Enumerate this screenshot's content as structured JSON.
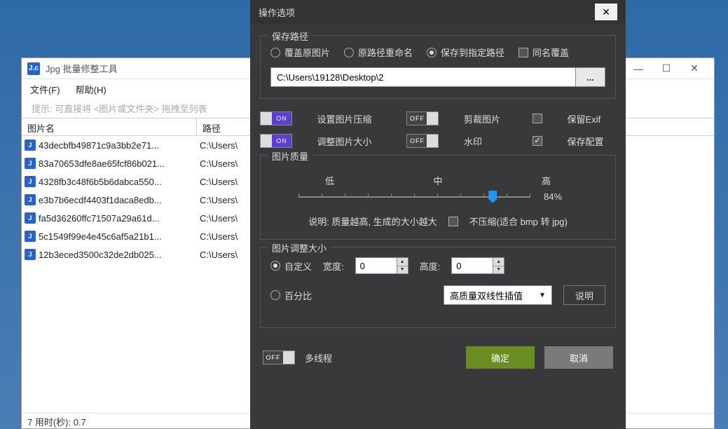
{
  "main_window": {
    "icon_text": "J.c",
    "title": "Jpg 批量修整工具",
    "menu": {
      "file": "文件(F)",
      "help": "帮助(H)"
    },
    "hint": "提示: 可直接将 <图片或文件夹> 拖拽至列表",
    "columns": {
      "name": "图片名",
      "path": "路径"
    },
    "rows": [
      {
        "name": "43decbfb49871c9a3bb2e71...",
        "path": "C:\\Users\\"
      },
      {
        "name": "83a70653dfe8ae65fcf86b021...",
        "path": "C:\\Users\\"
      },
      {
        "name": "4328fb3c48f6b5b6dabca550...",
        "path": "C:\\Users\\"
      },
      {
        "name": "e3b7b6ecdf4403f1daca8edb...",
        "path": "C:\\Users\\"
      },
      {
        "name": "fa5d36260ffc71507a29a61d...",
        "path": "C:\\Users\\"
      },
      {
        "name": "5c1549f99e4e45c6af5a21b1...",
        "path": "C:\\Users\\"
      },
      {
        "name": "12b3eced3500c32de2db025...",
        "path": "C:\\Users\\"
      }
    ],
    "status": "7  用时(秒): 0.7"
  },
  "dialog": {
    "title": "操作选项",
    "save_path": {
      "legend": "保存路径",
      "opt_overwrite": "覆盖原图片",
      "opt_rename": "原路径重命名",
      "opt_saveto": "保存到指定路径",
      "same_name": "同名覆盖",
      "path_value": "C:\\Users\\19128\\Desktop\\2",
      "browse": "..."
    },
    "toggles": {
      "compress": "设置图片压缩",
      "resize": "调整图片大小",
      "crop": "剪裁图片",
      "watermark": "水印",
      "keep_exif": "保留Exif",
      "save_config": "保存配置"
    },
    "quality": {
      "legend": "图片质量",
      "low": "低",
      "mid": "中",
      "high": "高",
      "percent": "84%",
      "note": "说明: 质量越高, 生成的大小越大",
      "no_compress": "不压缩(适合 bmp 转 jpg)"
    },
    "resize_group": {
      "legend": "图片调整大小",
      "custom": "自定义",
      "percent": "百分比",
      "width_label": "宽度:",
      "height_label": "高度:",
      "width_value": "0",
      "height_value": "0",
      "interp": "高质量双线性插值",
      "explain": "说明"
    },
    "footer": {
      "multithread": "多线程",
      "ok": "确定",
      "cancel": "取消"
    }
  }
}
